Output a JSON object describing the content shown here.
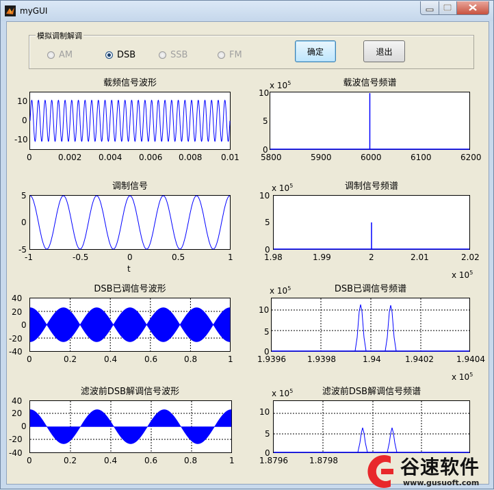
{
  "window": {
    "title": "myGUI"
  },
  "panel": {
    "title": "模拟调制解调"
  },
  "radios": [
    {
      "label": "AM",
      "checked": false,
      "enabled": false
    },
    {
      "label": "DSB",
      "checked": true,
      "enabled": true
    },
    {
      "label": "SSB",
      "checked": false,
      "enabled": false
    },
    {
      "label": "FM",
      "checked": false,
      "enabled": false
    }
  ],
  "buttons": {
    "confirm": "确定",
    "exit": "退出"
  },
  "plots": {
    "carrier_wave": {
      "title": "载频信号波形",
      "yticks": [
        "10",
        "0",
        "-10"
      ],
      "xticks": [
        "0",
        "0.002",
        "0.004",
        "0.006",
        "0.008",
        "0.01"
      ]
    },
    "carrier_spectrum": {
      "title": "载波信号频谱",
      "yticks": [
        "10",
        "5",
        "0"
      ],
      "xticks": [
        "5800",
        "5900",
        "6000",
        "6100",
        "6200"
      ],
      "yexp": "x 10",
      "yexp_power": "5"
    },
    "modulating_wave": {
      "title": "调制信号",
      "yticks": [
        "5",
        "0",
        "-5"
      ],
      "xticks": [
        "-1",
        "-0.5",
        "0",
        "0.5",
        "1"
      ],
      "xlabel": "t"
    },
    "modulating_spectrum": {
      "title": "调制信号频谱",
      "yticks": [
        "10",
        "5",
        "0"
      ],
      "xticks": [
        "1.98",
        "1.99",
        "2",
        "2.01",
        "2.02"
      ],
      "yexp": "x 10",
      "yexp_power": "5",
      "xexp": "x 10",
      "xexp_power": "5"
    },
    "dsb_wave": {
      "title": "DSB已调信号波形",
      "yticks": [
        "40",
        "20",
        "0",
        "-20",
        "-40"
      ],
      "xticks": [
        "0",
        "0.2",
        "0.4",
        "0.6",
        "0.8",
        "1"
      ]
    },
    "dsb_spectrum": {
      "title": "DSB已调信号频谱",
      "yticks": [
        "10",
        "5",
        "0"
      ],
      "xticks": [
        "1.9396",
        "1.9398",
        "1.94",
        "1.9402",
        "1.9404"
      ],
      "yexp": "x 10",
      "yexp_power": "5",
      "xexp": "x 10",
      "xexp_power": "5"
    },
    "demod_wave": {
      "title": "滤波前DSB解调信号波形",
      "yticks": [
        "40",
        "20",
        "0",
        "-20",
        "-40"
      ],
      "xticks": [
        "0",
        "0.2",
        "0.4",
        "0.6",
        "0.8",
        "1"
      ]
    },
    "demod_spectrum": {
      "title": "滤波前DSB解调信号频谱",
      "yticks": [
        "10",
        "5",
        "0"
      ],
      "xticks": [
        "1.8796",
        "1.8798"
      ],
      "yexp": "x 10",
      "yexp_power": "5"
    }
  },
  "watermark": {
    "name": "谷速软件",
    "url": "www.gusuoft.com"
  },
  "colors": {
    "trace": "#0000ff",
    "grid": "#000000",
    "window_bg": "#ece9d8"
  }
}
